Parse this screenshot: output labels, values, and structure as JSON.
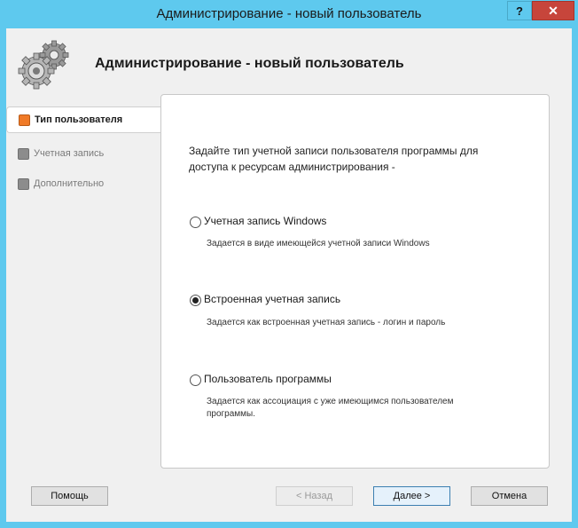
{
  "window": {
    "title": "Администрирование - новый пользователь",
    "help_label": "?",
    "close_label": "✕"
  },
  "header": {
    "title": "Администрирование - новый пользователь"
  },
  "steps": [
    {
      "label": "Тип пользователя",
      "active": true
    },
    {
      "label": "Учетная запись",
      "active": false
    },
    {
      "label": "Дополнительно",
      "active": false
    }
  ],
  "panel": {
    "intro": "Задайте тип учетной записи пользователя программы для доступа к ресурсам администрирования -",
    "options": [
      {
        "label": "Учетная запись Windows",
        "description": "Задается в виде имеющейся учетной записи Windows",
        "checked": false
      },
      {
        "label": "Встроенная учетная запись",
        "description": "Задается как встроенная учетная запись - логин и пароль",
        "checked": true
      },
      {
        "label": "Пользователь программы",
        "description": "Задается как ассоциация с уже имеющимся пользователем программы.",
        "checked": false
      }
    ]
  },
  "buttons": {
    "help": "Помощь",
    "back": "< Назад",
    "next": "Далее >",
    "cancel": "Отмена"
  },
  "colors": {
    "titlebar": "#5ec9ee",
    "active_step": "#f07a27",
    "close": "#c7453b"
  }
}
